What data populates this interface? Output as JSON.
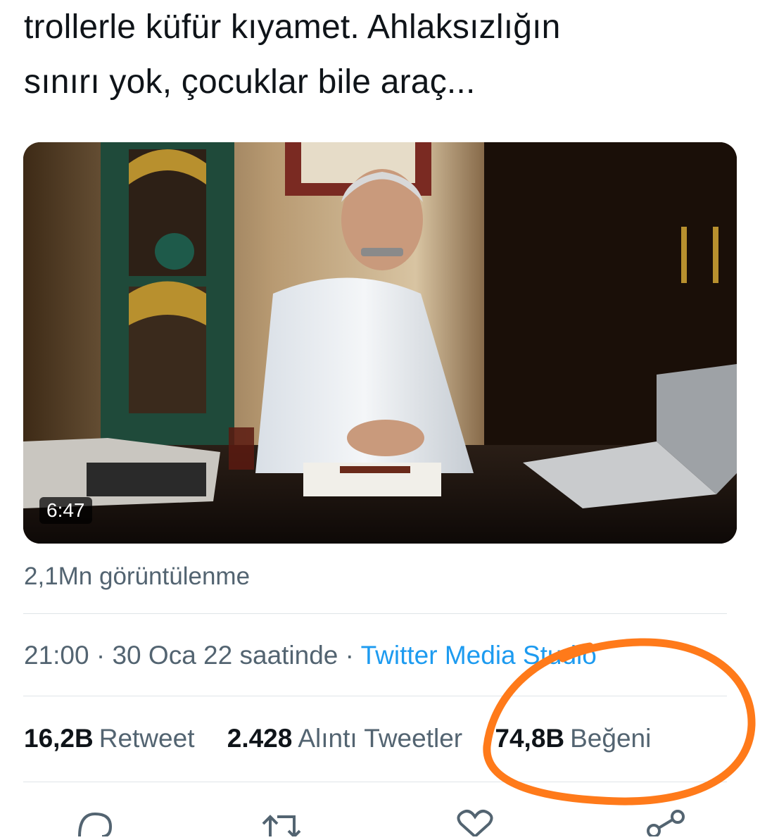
{
  "tweet": {
    "text_line_1": "trollerle küfür kıyamet. Ahlaksızlığın",
    "text_line_2": "sınırı yok, çocuklar bile araç..."
  },
  "media": {
    "duration": "6:47",
    "views_text": "2,1Mn görüntülenme"
  },
  "timestamp": {
    "time": "21:00",
    "separator": " · ",
    "date_text": "30 Oca 22 saatinde",
    "source": "Twitter Media Studio"
  },
  "stats": {
    "retweets_count": "16,2B",
    "retweets_label": "Retweet",
    "quotes_count": "2.428",
    "quotes_label": "Alıntı Tweetler",
    "likes_count": "74,8B",
    "likes_label": "Beğeni"
  },
  "actions": [
    "reply-icon",
    "retweet-icon",
    "like-icon",
    "share-icon"
  ],
  "colors": {
    "text_primary": "#0f1419",
    "text_secondary": "#536471",
    "link": "#1d9bf0",
    "annotation": "#ff7a1a"
  }
}
